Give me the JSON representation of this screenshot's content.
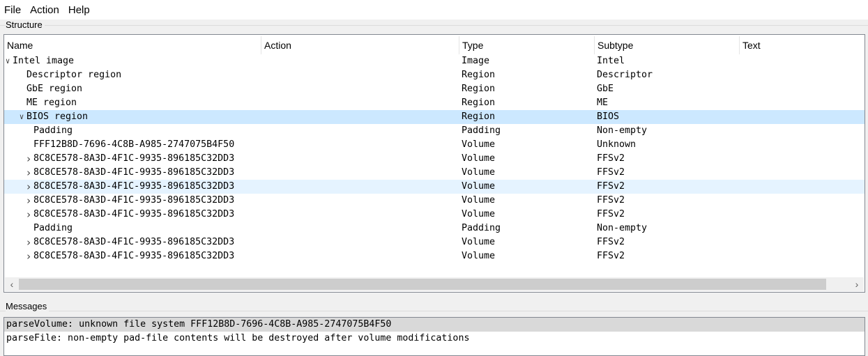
{
  "menu": [
    "File",
    "Action",
    "Help"
  ],
  "structure_label": "Structure",
  "columns": [
    "Name",
    "Action",
    "Type",
    "Subtype",
    "Text"
  ],
  "rows": [
    {
      "name": "Intel image",
      "type": "Image",
      "subtype": "Intel",
      "level": 0,
      "expander": "expanded"
    },
    {
      "name": "Descriptor region",
      "type": "Region",
      "subtype": "Descriptor",
      "level": 1,
      "expander": "none"
    },
    {
      "name": "GbE region",
      "type": "Region",
      "subtype": "GbE",
      "level": 1,
      "expander": "none"
    },
    {
      "name": "ME region",
      "type": "Region",
      "subtype": "ME",
      "level": 1,
      "expander": "none"
    },
    {
      "name": "BIOS region",
      "type": "Region",
      "subtype": "BIOS",
      "level": 1,
      "expander": "expanded",
      "state": "selected"
    },
    {
      "name": "Padding",
      "type": "Padding",
      "subtype": "Non-empty",
      "level": 2,
      "expander": "none"
    },
    {
      "name": "FFF12B8D-7696-4C8B-A985-2747075B4F50",
      "type": "Volume",
      "subtype": "Unknown",
      "level": 2,
      "expander": "none"
    },
    {
      "name": "8C8CE578-8A3D-4F1C-9935-896185C32DD3",
      "type": "Volume",
      "subtype": "FFSv2",
      "level": 2,
      "expander": "collapsed"
    },
    {
      "name": "8C8CE578-8A3D-4F1C-9935-896185C32DD3",
      "type": "Volume",
      "subtype": "FFSv2",
      "level": 2,
      "expander": "collapsed"
    },
    {
      "name": "8C8CE578-8A3D-4F1C-9935-896185C32DD3",
      "type": "Volume",
      "subtype": "FFSv2",
      "level": 2,
      "expander": "collapsed",
      "state": "hover"
    },
    {
      "name": "8C8CE578-8A3D-4F1C-9935-896185C32DD3",
      "type": "Volume",
      "subtype": "FFSv2",
      "level": 2,
      "expander": "collapsed"
    },
    {
      "name": "8C8CE578-8A3D-4F1C-9935-896185C32DD3",
      "type": "Volume",
      "subtype": "FFSv2",
      "level": 2,
      "expander": "collapsed"
    },
    {
      "name": "Padding",
      "type": "Padding",
      "subtype": "Non-empty",
      "level": 2,
      "expander": "none"
    },
    {
      "name": "8C8CE578-8A3D-4F1C-9935-896185C32DD3",
      "type": "Volume",
      "subtype": "FFSv2",
      "level": 2,
      "expander": "collapsed"
    },
    {
      "name": "8C8CE578-8A3D-4F1C-9935-896185C32DD3",
      "type": "Volume",
      "subtype": "FFSv2",
      "level": 2,
      "expander": "collapsed"
    }
  ],
  "messages_label": "Messages",
  "messages": [
    "parseVolume: unknown file system FFF12B8D-7696-4C8B-A985-2747075B4F50",
    "parseFile: non-empty pad-file contents will be destroyed after volume modifications"
  ],
  "scroll": {
    "left": "‹",
    "right": "›"
  }
}
